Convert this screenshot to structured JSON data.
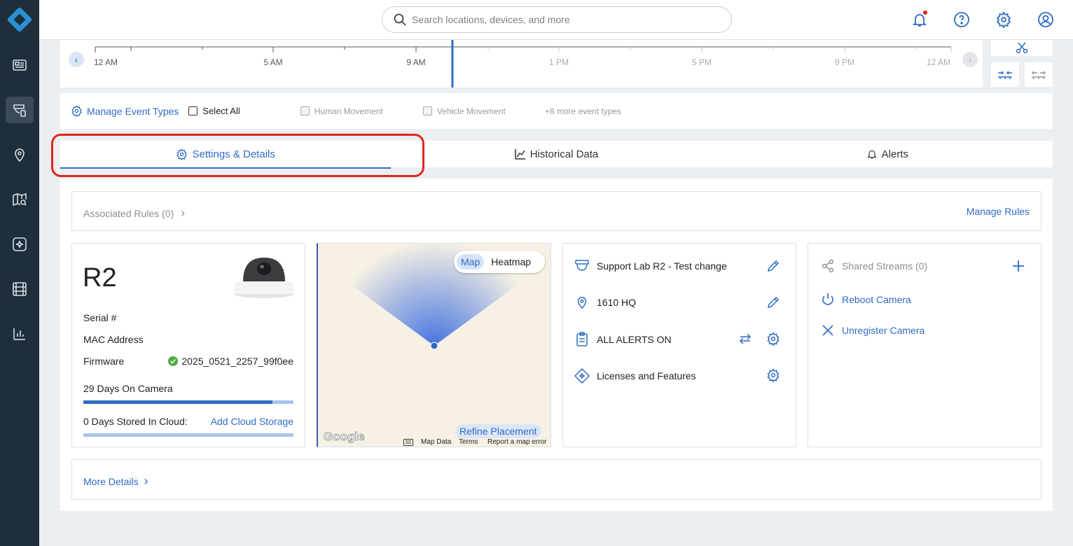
{
  "search": {
    "placeholder": "Search locations, devices, and more"
  },
  "timeline": {
    "labels": [
      "12 AM",
      "5 AM",
      "9 AM",
      "1 PM",
      "5 PM",
      "9 PM",
      "12 AM"
    ]
  },
  "events": {
    "manage_label": "Manage Event Types",
    "select_all": "Select All",
    "types": [
      "Human Movement",
      "Vehicle Movement"
    ],
    "more": "+8 more event types"
  },
  "tabs": [
    {
      "label": "Settings & Details"
    },
    {
      "label": "Historical Data"
    },
    {
      "label": "Alerts"
    }
  ],
  "rules": {
    "label": "Associated Rules (0)",
    "manage": "Manage Rules"
  },
  "camera": {
    "name": "R2",
    "serial_label": "Serial #",
    "mac_label": "MAC Address",
    "firmware_label": "Firmware",
    "firmware_value": "2025_0521_2257_99f0ee",
    "days_on_camera": "29 Days On Camera",
    "days_on_camera_progress": 0.9,
    "days_in_cloud": "0 Days Stored In Cloud:",
    "add_cloud": "Add Cloud Storage"
  },
  "map": {
    "toggle_map": "Map",
    "toggle_heatmap": "Heatmap",
    "refine": "Refine Placement",
    "google": "Google",
    "map_data": "Map Data",
    "terms": "Terms",
    "report": "Report a map error"
  },
  "details": {
    "camera_name": "Support Lab R2 - Test change",
    "location": "1610 HQ",
    "alerts": "ALL ALERTS ON",
    "licenses": "Licenses and Features"
  },
  "actions": {
    "shared_streams": "Shared Streams (0)",
    "reboot": "Reboot Camera",
    "unregister": "Unregister Camera"
  },
  "more_details": "More Details"
}
